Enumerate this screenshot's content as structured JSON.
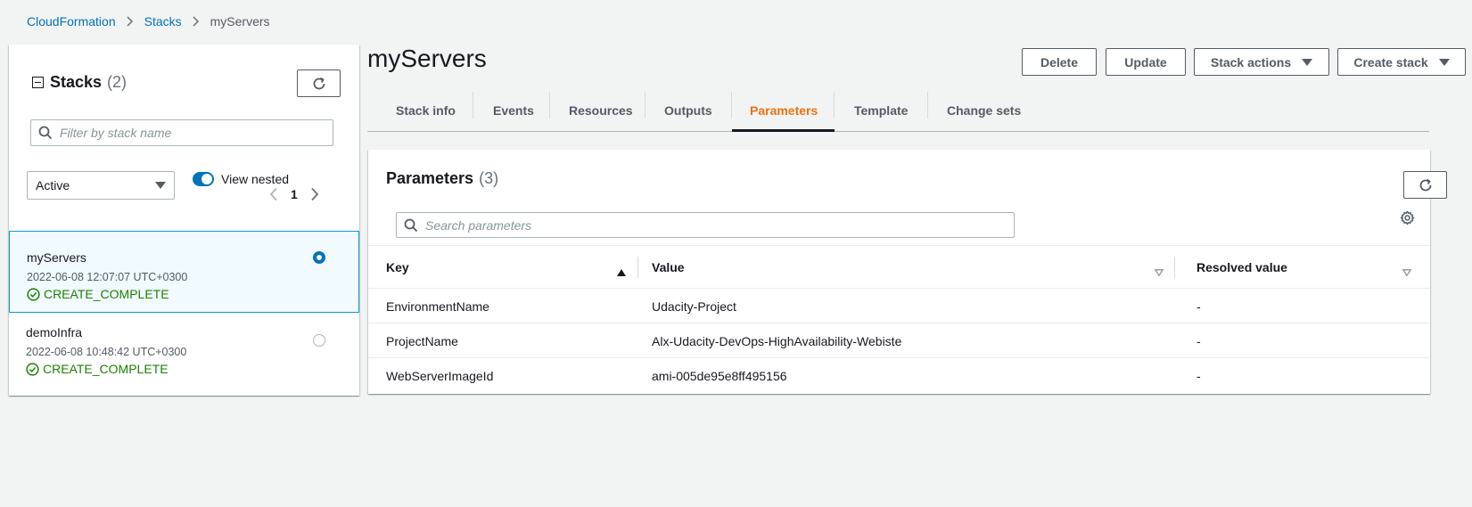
{
  "breadcrumb": {
    "items": [
      "CloudFormation",
      "Stacks"
    ],
    "current": "myServers"
  },
  "stacks_panel": {
    "title": "Stacks",
    "count": "(2)",
    "filter_placeholder": "Filter by stack name",
    "status_filter": "Active",
    "view_nested_label": "View nested",
    "view_nested_on": true,
    "page": "1",
    "stacks": [
      {
        "name": "myServers",
        "date": "2022-06-08 12:07:07 UTC+0300",
        "status": "CREATE_COMPLETE",
        "selected": true
      },
      {
        "name": "demoInfra",
        "date": "2022-06-08 10:48:42 UTC+0300",
        "status": "CREATE_COMPLETE",
        "selected": false
      }
    ]
  },
  "main": {
    "title": "myServers",
    "actions": {
      "delete": "Delete",
      "update": "Update",
      "stack_actions": "Stack actions",
      "create_stack": "Create stack"
    },
    "tabs": [
      "Stack info",
      "Events",
      "Resources",
      "Outputs",
      "Parameters",
      "Template",
      "Change sets"
    ],
    "active_tab": "Parameters"
  },
  "parameters": {
    "title": "Parameters",
    "count": "(3)",
    "search_placeholder": "Search parameters",
    "columns": [
      "Key",
      "Value",
      "Resolved value"
    ],
    "rows": [
      {
        "key": "EnvironmentName",
        "value": "Udacity-Project",
        "resolved": "-"
      },
      {
        "key": "ProjectName",
        "value": "Alx-Udacity-DevOps-HighAvailability-Webiste",
        "resolved": "-"
      },
      {
        "key": "WebServerImageId",
        "value": "ami-005de95e8ff495156",
        "resolved": "-"
      }
    ]
  },
  "colors": {
    "link": "#0073bb",
    "active_tab": "#ec7211",
    "success": "#1d8102",
    "selected_bg": "#f1faff",
    "selected_border": "#00a1c9"
  }
}
